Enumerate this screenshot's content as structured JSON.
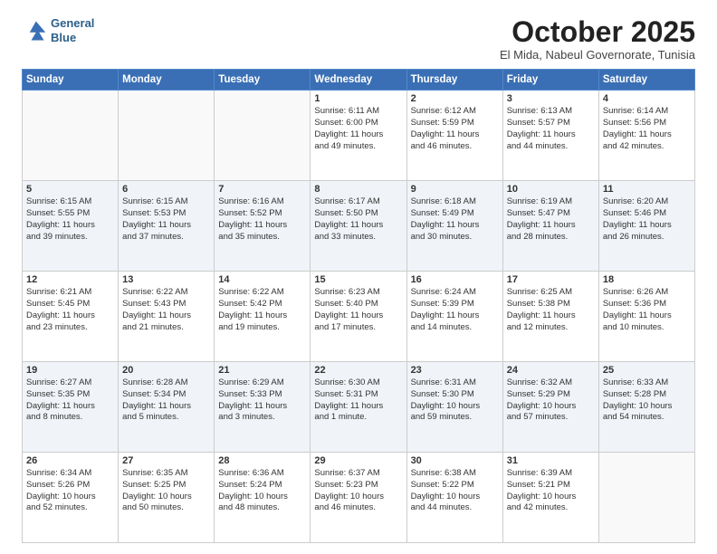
{
  "logo": {
    "line1": "General",
    "line2": "Blue"
  },
  "title": "October 2025",
  "location": "El Mida, Nabeul Governorate, Tunisia",
  "days_header": [
    "Sunday",
    "Monday",
    "Tuesday",
    "Wednesday",
    "Thursday",
    "Friday",
    "Saturday"
  ],
  "weeks": [
    [
      {
        "day": "",
        "info": ""
      },
      {
        "day": "",
        "info": ""
      },
      {
        "day": "",
        "info": ""
      },
      {
        "day": "1",
        "info": "Sunrise: 6:11 AM\nSunset: 6:00 PM\nDaylight: 11 hours\nand 49 minutes."
      },
      {
        "day": "2",
        "info": "Sunrise: 6:12 AM\nSunset: 5:59 PM\nDaylight: 11 hours\nand 46 minutes."
      },
      {
        "day": "3",
        "info": "Sunrise: 6:13 AM\nSunset: 5:57 PM\nDaylight: 11 hours\nand 44 minutes."
      },
      {
        "day": "4",
        "info": "Sunrise: 6:14 AM\nSunset: 5:56 PM\nDaylight: 11 hours\nand 42 minutes."
      }
    ],
    [
      {
        "day": "5",
        "info": "Sunrise: 6:15 AM\nSunset: 5:55 PM\nDaylight: 11 hours\nand 39 minutes."
      },
      {
        "day": "6",
        "info": "Sunrise: 6:15 AM\nSunset: 5:53 PM\nDaylight: 11 hours\nand 37 minutes."
      },
      {
        "day": "7",
        "info": "Sunrise: 6:16 AM\nSunset: 5:52 PM\nDaylight: 11 hours\nand 35 minutes."
      },
      {
        "day": "8",
        "info": "Sunrise: 6:17 AM\nSunset: 5:50 PM\nDaylight: 11 hours\nand 33 minutes."
      },
      {
        "day": "9",
        "info": "Sunrise: 6:18 AM\nSunset: 5:49 PM\nDaylight: 11 hours\nand 30 minutes."
      },
      {
        "day": "10",
        "info": "Sunrise: 6:19 AM\nSunset: 5:47 PM\nDaylight: 11 hours\nand 28 minutes."
      },
      {
        "day": "11",
        "info": "Sunrise: 6:20 AM\nSunset: 5:46 PM\nDaylight: 11 hours\nand 26 minutes."
      }
    ],
    [
      {
        "day": "12",
        "info": "Sunrise: 6:21 AM\nSunset: 5:45 PM\nDaylight: 11 hours\nand 23 minutes."
      },
      {
        "day": "13",
        "info": "Sunrise: 6:22 AM\nSunset: 5:43 PM\nDaylight: 11 hours\nand 21 minutes."
      },
      {
        "day": "14",
        "info": "Sunrise: 6:22 AM\nSunset: 5:42 PM\nDaylight: 11 hours\nand 19 minutes."
      },
      {
        "day": "15",
        "info": "Sunrise: 6:23 AM\nSunset: 5:40 PM\nDaylight: 11 hours\nand 17 minutes."
      },
      {
        "day": "16",
        "info": "Sunrise: 6:24 AM\nSunset: 5:39 PM\nDaylight: 11 hours\nand 14 minutes."
      },
      {
        "day": "17",
        "info": "Sunrise: 6:25 AM\nSunset: 5:38 PM\nDaylight: 11 hours\nand 12 minutes."
      },
      {
        "day": "18",
        "info": "Sunrise: 6:26 AM\nSunset: 5:36 PM\nDaylight: 11 hours\nand 10 minutes."
      }
    ],
    [
      {
        "day": "19",
        "info": "Sunrise: 6:27 AM\nSunset: 5:35 PM\nDaylight: 11 hours\nand 8 minutes."
      },
      {
        "day": "20",
        "info": "Sunrise: 6:28 AM\nSunset: 5:34 PM\nDaylight: 11 hours\nand 5 minutes."
      },
      {
        "day": "21",
        "info": "Sunrise: 6:29 AM\nSunset: 5:33 PM\nDaylight: 11 hours\nand 3 minutes."
      },
      {
        "day": "22",
        "info": "Sunrise: 6:30 AM\nSunset: 5:31 PM\nDaylight: 11 hours\nand 1 minute."
      },
      {
        "day": "23",
        "info": "Sunrise: 6:31 AM\nSunset: 5:30 PM\nDaylight: 10 hours\nand 59 minutes."
      },
      {
        "day": "24",
        "info": "Sunrise: 6:32 AM\nSunset: 5:29 PM\nDaylight: 10 hours\nand 57 minutes."
      },
      {
        "day": "25",
        "info": "Sunrise: 6:33 AM\nSunset: 5:28 PM\nDaylight: 10 hours\nand 54 minutes."
      }
    ],
    [
      {
        "day": "26",
        "info": "Sunrise: 6:34 AM\nSunset: 5:26 PM\nDaylight: 10 hours\nand 52 minutes."
      },
      {
        "day": "27",
        "info": "Sunrise: 6:35 AM\nSunset: 5:25 PM\nDaylight: 10 hours\nand 50 minutes."
      },
      {
        "day": "28",
        "info": "Sunrise: 6:36 AM\nSunset: 5:24 PM\nDaylight: 10 hours\nand 48 minutes."
      },
      {
        "day": "29",
        "info": "Sunrise: 6:37 AM\nSunset: 5:23 PM\nDaylight: 10 hours\nand 46 minutes."
      },
      {
        "day": "30",
        "info": "Sunrise: 6:38 AM\nSunset: 5:22 PM\nDaylight: 10 hours\nand 44 minutes."
      },
      {
        "day": "31",
        "info": "Sunrise: 6:39 AM\nSunset: 5:21 PM\nDaylight: 10 hours\nand 42 minutes."
      },
      {
        "day": "",
        "info": ""
      }
    ]
  ]
}
